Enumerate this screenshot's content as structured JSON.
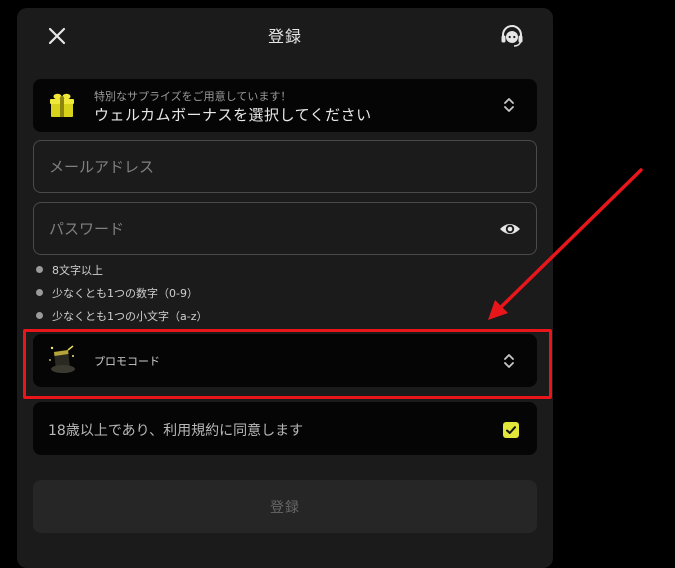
{
  "header": {
    "title": "登録"
  },
  "bonus": {
    "subtitle": "特別なサプライズをご用意しています！",
    "label": "ウェルカムボーナスを選択してください"
  },
  "email": {
    "placeholder": "メールアドレス"
  },
  "password": {
    "placeholder": "パスワード"
  },
  "password_rules": [
    "8文字以上",
    "少なくとも1つの数字（0-9）",
    "少なくとも1つの小文字（a-z）"
  ],
  "promo": {
    "label": "プロモコード"
  },
  "agreement": {
    "text": "18歳以上であり、利用規約に同意します",
    "checked": true
  },
  "submit": {
    "label": "登録"
  },
  "colors": {
    "background": "#000000",
    "modal": "#1b1b1b",
    "row_dark": "#050505",
    "accent_yellow": "#e3e63a",
    "annotation_red": "#e8161b"
  },
  "icons": {
    "close": "close-icon",
    "support": "headset-icon",
    "bonus": "gift-icon",
    "password_toggle": "eye-icon",
    "promo": "magic-hat-icon",
    "select": "chevron-up-down-icon",
    "check": "check-icon"
  },
  "annotation": {
    "type": "red-arrow-and-box",
    "target": "promo-code-row"
  }
}
